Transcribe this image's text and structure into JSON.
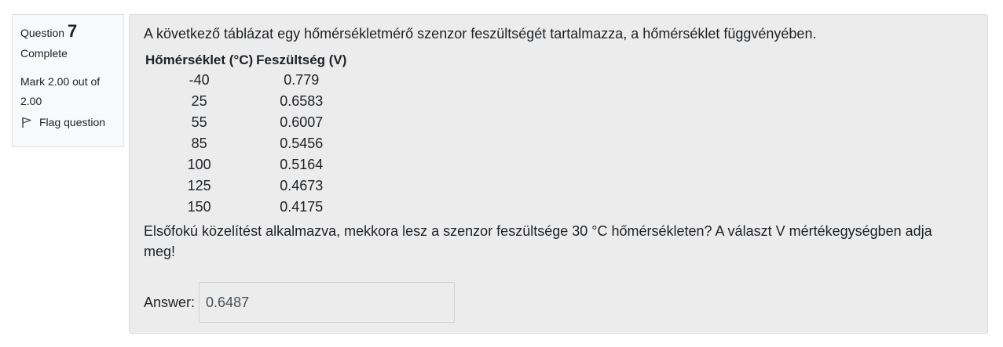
{
  "info": {
    "question_label": "Question",
    "question_number": "7",
    "state": "Complete",
    "grade": "Mark 2.00 out of 2.00",
    "flag_label": "Flag question"
  },
  "question": {
    "intro": "A következő táblázat egy hőmérsékletmérő szenzor feszültségét tartalmazza, a hőmérséklet függvényében.",
    "table": {
      "headers": [
        "Hőmérséklet (°C)",
        "Feszültség (V)"
      ],
      "rows": [
        [
          "-40",
          "0.779"
        ],
        [
          "25",
          "0.6583"
        ],
        [
          "55",
          "0.6007"
        ],
        [
          "85",
          "0.5456"
        ],
        [
          "100",
          "0.5164"
        ],
        [
          "125",
          "0.4673"
        ],
        [
          "150",
          "0.4175"
        ]
      ]
    },
    "prompt": "Elsőfokú közelítést alkalmazva, mekkora lesz a szenzor feszültsége 30 °C hőmérsékleten? A választ V mértékegységben adja meg!",
    "answer_label": "Answer:",
    "answer_value": "0.6487"
  },
  "icons": {
    "flag": "flag-icon"
  }
}
